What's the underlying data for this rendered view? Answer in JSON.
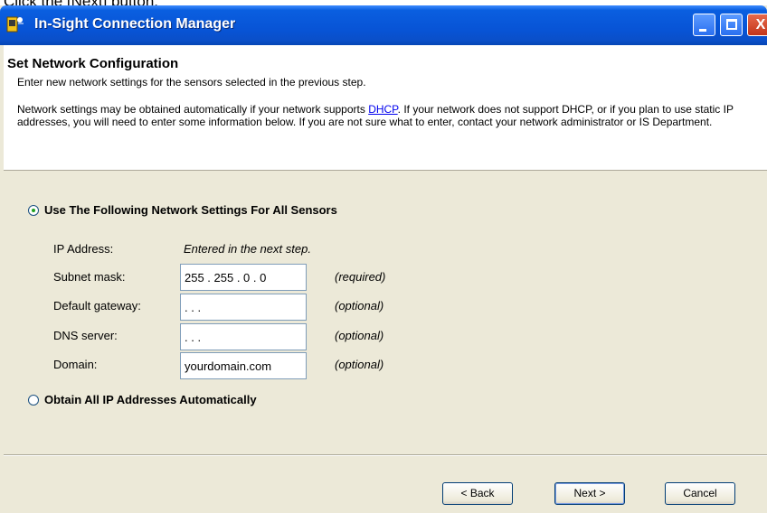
{
  "instruction": "Click the [Next] button.",
  "window": {
    "title": "In-Sight Connection Manager",
    "buttons": {
      "minimize": "_",
      "maximize": "□",
      "close": "X"
    }
  },
  "header": {
    "title": "Set Network Configuration",
    "subtitle": "Enter new network settings for the sensors selected in the previous step.",
    "body_pre": "Network settings may be obtained automatically if your network supports ",
    "body_link": "DHCP",
    "body_post": ".  If your network does not support DHCP, or if you plan to use static IP addresses, you will need to enter some information below.  If you are not sure what to enter, contact your network administrator or IS Department."
  },
  "options": {
    "use_following": {
      "label": "Use The Following Network Settings For All Sensors",
      "selected": true
    },
    "obtain_auto": {
      "label": "Obtain All IP Addresses Automatically",
      "selected": false
    }
  },
  "fields": {
    "ip": {
      "label": "IP Address:",
      "value": "Entered in the next step."
    },
    "subnet": {
      "label": "Subnet mask:",
      "value": "255 . 255 .   0  .   0",
      "note": "(required)"
    },
    "gateway": {
      "label": "Default gateway:",
      "value": "      .       .       .",
      "note": "(optional)"
    },
    "dns": {
      "label": "DNS server:",
      "value": "      .       .       .",
      "note": "(optional)"
    },
    "domain": {
      "label": "Domain:",
      "value": "yourdomain.com",
      "note": "(optional)"
    }
  },
  "footer": {
    "back": "< Back",
    "next": "Next >",
    "cancel": "Cancel"
  },
  "colors": {
    "title_bar": "#0854d6",
    "dialog": "#ece9d8",
    "link": "#0000ee"
  }
}
